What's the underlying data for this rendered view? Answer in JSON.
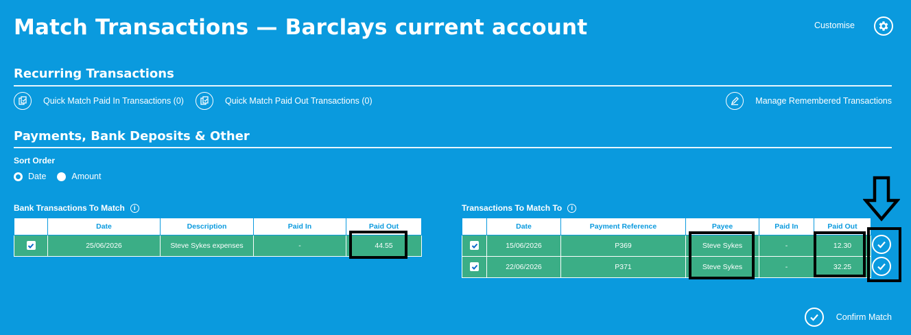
{
  "header": {
    "title": "Match Transactions — Barclays current account",
    "customise_label": "Customise",
    "gear_icon": "gear-icon"
  },
  "recurring": {
    "title": "Recurring Transactions",
    "quick_paid_in": "Quick Match Paid In Transactions (0)",
    "quick_paid_out": "Quick Match Paid Out Transactions (0)",
    "manage_remembered": "Manage Remembered Transactions"
  },
  "payments": {
    "title": "Payments, Bank Deposits & Other",
    "sort_order_label": "Sort Order",
    "sort_options": [
      "Date",
      "Amount"
    ],
    "sort_selected": "Date"
  },
  "bank_table": {
    "title": "Bank Transactions To Match",
    "info_icon": "i",
    "columns": [
      "Date",
      "Description",
      "Paid In",
      "Paid Out"
    ],
    "rows": [
      {
        "checked": true,
        "date": "25/06/2026",
        "description": "Steve Sykes expenses",
        "paid_in": "-",
        "paid_out": "44.55"
      }
    ]
  },
  "match_table": {
    "title": "Transactions To Match To",
    "info_icon": "i",
    "columns": [
      "Date",
      "Payment Reference",
      "Payee",
      "Paid In",
      "Paid Out"
    ],
    "rows": [
      {
        "checked": true,
        "date": "15/06/2026",
        "reference": "P369",
        "payee": "Steve Sykes",
        "paid_in": "-",
        "paid_out": "12.30"
      },
      {
        "checked": true,
        "date": "22/06/2026",
        "reference": "P371",
        "payee": "Steve Sykes",
        "paid_in": "-",
        "paid_out": "32.25"
      }
    ]
  },
  "confirm": {
    "label": "Confirm Match"
  },
  "colors": {
    "background": "#0a9ade",
    "row_green": "#3bae86",
    "highlight": "#000000"
  }
}
